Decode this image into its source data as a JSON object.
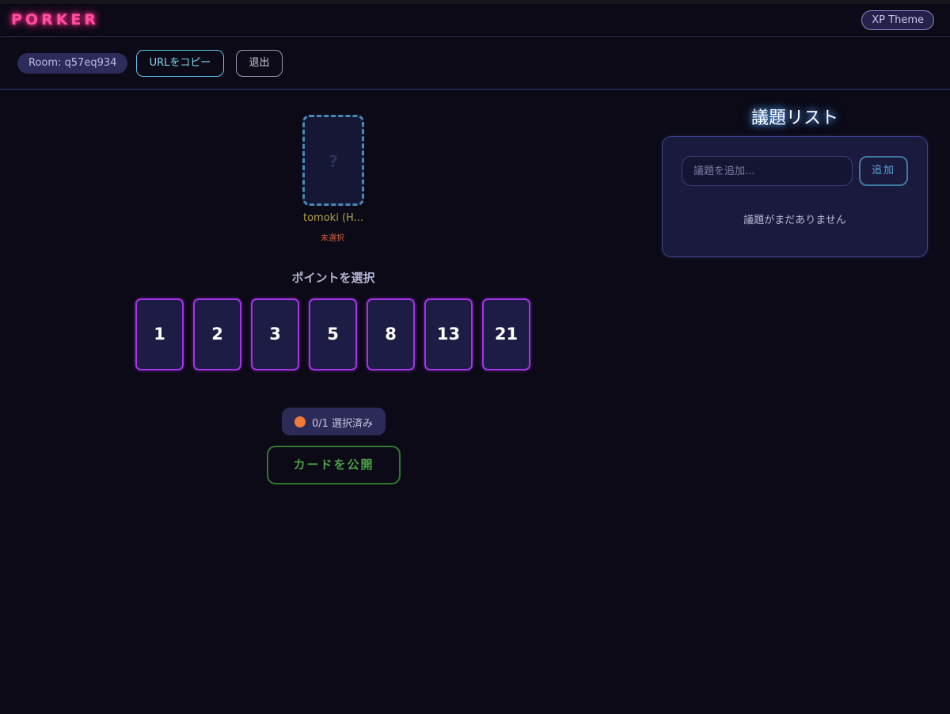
{
  "header": {
    "logo": "PORKER",
    "theme_button": "XP Theme"
  },
  "toolbar": {
    "room_label": "Room: q57eq934",
    "copy_url_button": "URLをコピー",
    "exit_button": "退出"
  },
  "players": [
    {
      "card_face": "?",
      "name": "tomoki (H...",
      "status": "未選択"
    }
  ],
  "point_selector": {
    "title": "ポイントを選択",
    "cards": [
      "1",
      "2",
      "3",
      "5",
      "8",
      "13",
      "21"
    ]
  },
  "vote_status": {
    "text": "0/1 選択済み",
    "dot_color": "#f07a3a"
  },
  "reveal_button": "カードを公開",
  "topics": {
    "title": "議題リスト",
    "input_placeholder": "議題を追加...",
    "add_button": "追加",
    "empty_message": "議題がまだありません"
  },
  "colors": {
    "accent_pink": "#ff4fa3",
    "card_border": "#a534e6",
    "reveal_green": "#49a046",
    "link_cyan": "#7fd4f2"
  }
}
